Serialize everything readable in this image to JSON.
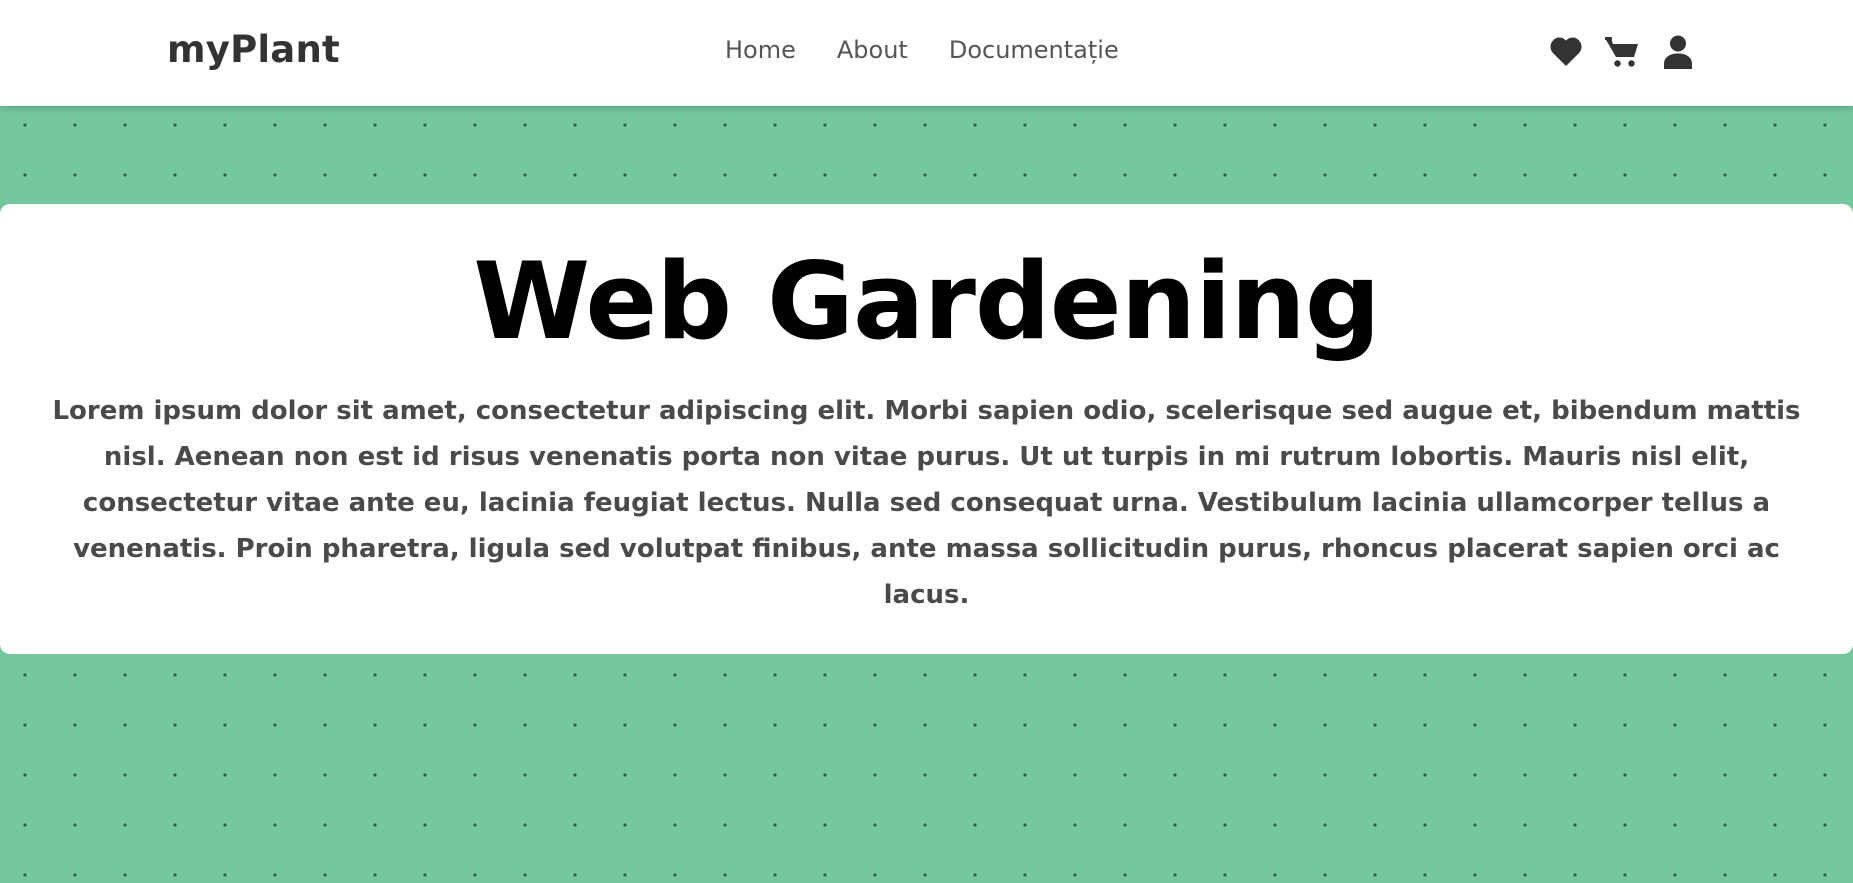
{
  "navbar": {
    "brand": "myPlant",
    "links": [
      "Home",
      "About",
      "Documentație"
    ],
    "icons": [
      "heart-icon",
      "cart-icon",
      "user-icon"
    ]
  },
  "hero": {
    "title": "Web Gardening",
    "text": "Lorem ipsum dolor sit amet, consectetur adipiscing elit. Morbi sapien odio, scelerisque sed augue et, bibendum mattis nisl. Aenean non est id risus venenatis porta non vitae purus. Ut ut turpis in mi rutrum lobortis. Mauris nisl elit, consectetur vitae ante eu, lacinia feugiat lectus. Nulla sed consequat urna. Vestibulum lacinia ullamcorper tellus a venenatis. Proin pharetra, ligula sed volutpat finibus, ante massa sollicitudin purus, rhoncus placerat sapien orci ac lacus."
  },
  "colors": {
    "background": "#72c79c",
    "dots": "#2f5d49",
    "navbar": "#ffffff",
    "brand_text": "#333333",
    "nav_text": "#555555",
    "icon": "#333333",
    "title": "#000000",
    "body_text": "#4a4a4a"
  }
}
